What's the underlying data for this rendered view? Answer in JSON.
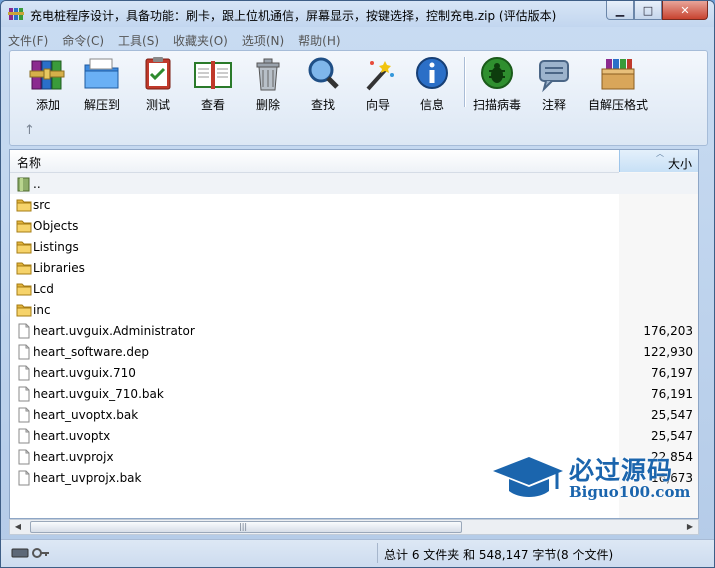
{
  "window": {
    "title": "充电桩程序设计，具备功能：刷卡，跟上位机通信，屏幕显示，按键选择，控制充电.zip (评估版本)",
    "minimize_label": "▁",
    "maximize_label": "□",
    "close_label": "✕"
  },
  "menu": {
    "items": [
      "文件(F)",
      "命令(C)",
      "工具(S)",
      "收藏夹(O)",
      "选项(N)",
      "帮助(H)"
    ]
  },
  "toolbar": {
    "buttons": [
      {
        "label": "添加",
        "icon": "books-stack-icon"
      },
      {
        "label": "解压到",
        "icon": "folder-extract-icon"
      },
      {
        "label": "测试",
        "icon": "clipboard-check-icon"
      },
      {
        "label": "查看",
        "icon": "open-book-icon"
      },
      {
        "label": "删除",
        "icon": "trash-can-icon"
      },
      {
        "label": "查找",
        "icon": "magnifier-icon"
      },
      {
        "label": "向导",
        "icon": "magic-wand-icon"
      },
      {
        "label": "信息",
        "icon": "info-icon"
      },
      {
        "label": "扫描病毒",
        "icon": "bug-scan-icon"
      },
      {
        "label": "注释",
        "icon": "comment-bubble-icon"
      },
      {
        "label": "自解压格式",
        "icon": "sfx-box-icon"
      }
    ],
    "up_arrow": "↑"
  },
  "filelist": {
    "columns": {
      "name": "名称",
      "size": "大小",
      "sort_indicator": "︿"
    },
    "rows": [
      {
        "name": "..",
        "size": "",
        "type": "parent"
      },
      {
        "name": "src",
        "size": "",
        "type": "folder"
      },
      {
        "name": "Objects",
        "size": "",
        "type": "folder"
      },
      {
        "name": "Listings",
        "size": "",
        "type": "folder"
      },
      {
        "name": "Libraries",
        "size": "",
        "type": "folder"
      },
      {
        "name": "Lcd",
        "size": "",
        "type": "folder"
      },
      {
        "name": "inc",
        "size": "",
        "type": "folder"
      },
      {
        "name": "heart.uvguix.Administrator",
        "size": "176,203",
        "type": "file"
      },
      {
        "name": "heart_software.dep",
        "size": "122,930",
        "type": "file"
      },
      {
        "name": "heart.uvguix.710",
        "size": "76,197",
        "type": "file"
      },
      {
        "name": "heart.uvguix_710.bak",
        "size": "76,191",
        "type": "file"
      },
      {
        "name": "heart_uvoptx.bak",
        "size": "25,547",
        "type": "file"
      },
      {
        "name": "heart.uvoptx",
        "size": "25,547",
        "type": "file"
      },
      {
        "name": "heart.uvprojx",
        "size": "22,854",
        "type": "file"
      },
      {
        "name": "heart_uvprojx.bak",
        "size": "16,673",
        "type": "file"
      }
    ]
  },
  "scrollbar": {
    "left": "◀",
    "right": "▶",
    "grip": "|||"
  },
  "status": {
    "text": "总计 6 文件夹 和 548,147 字节(8 个文件)"
  },
  "watermark": {
    "cn": "必过源码",
    "en": "Biguo100.com"
  },
  "colors": {
    "accent": "#1b65ad",
    "folder": "#f2c94c",
    "close": "#c8432f"
  }
}
